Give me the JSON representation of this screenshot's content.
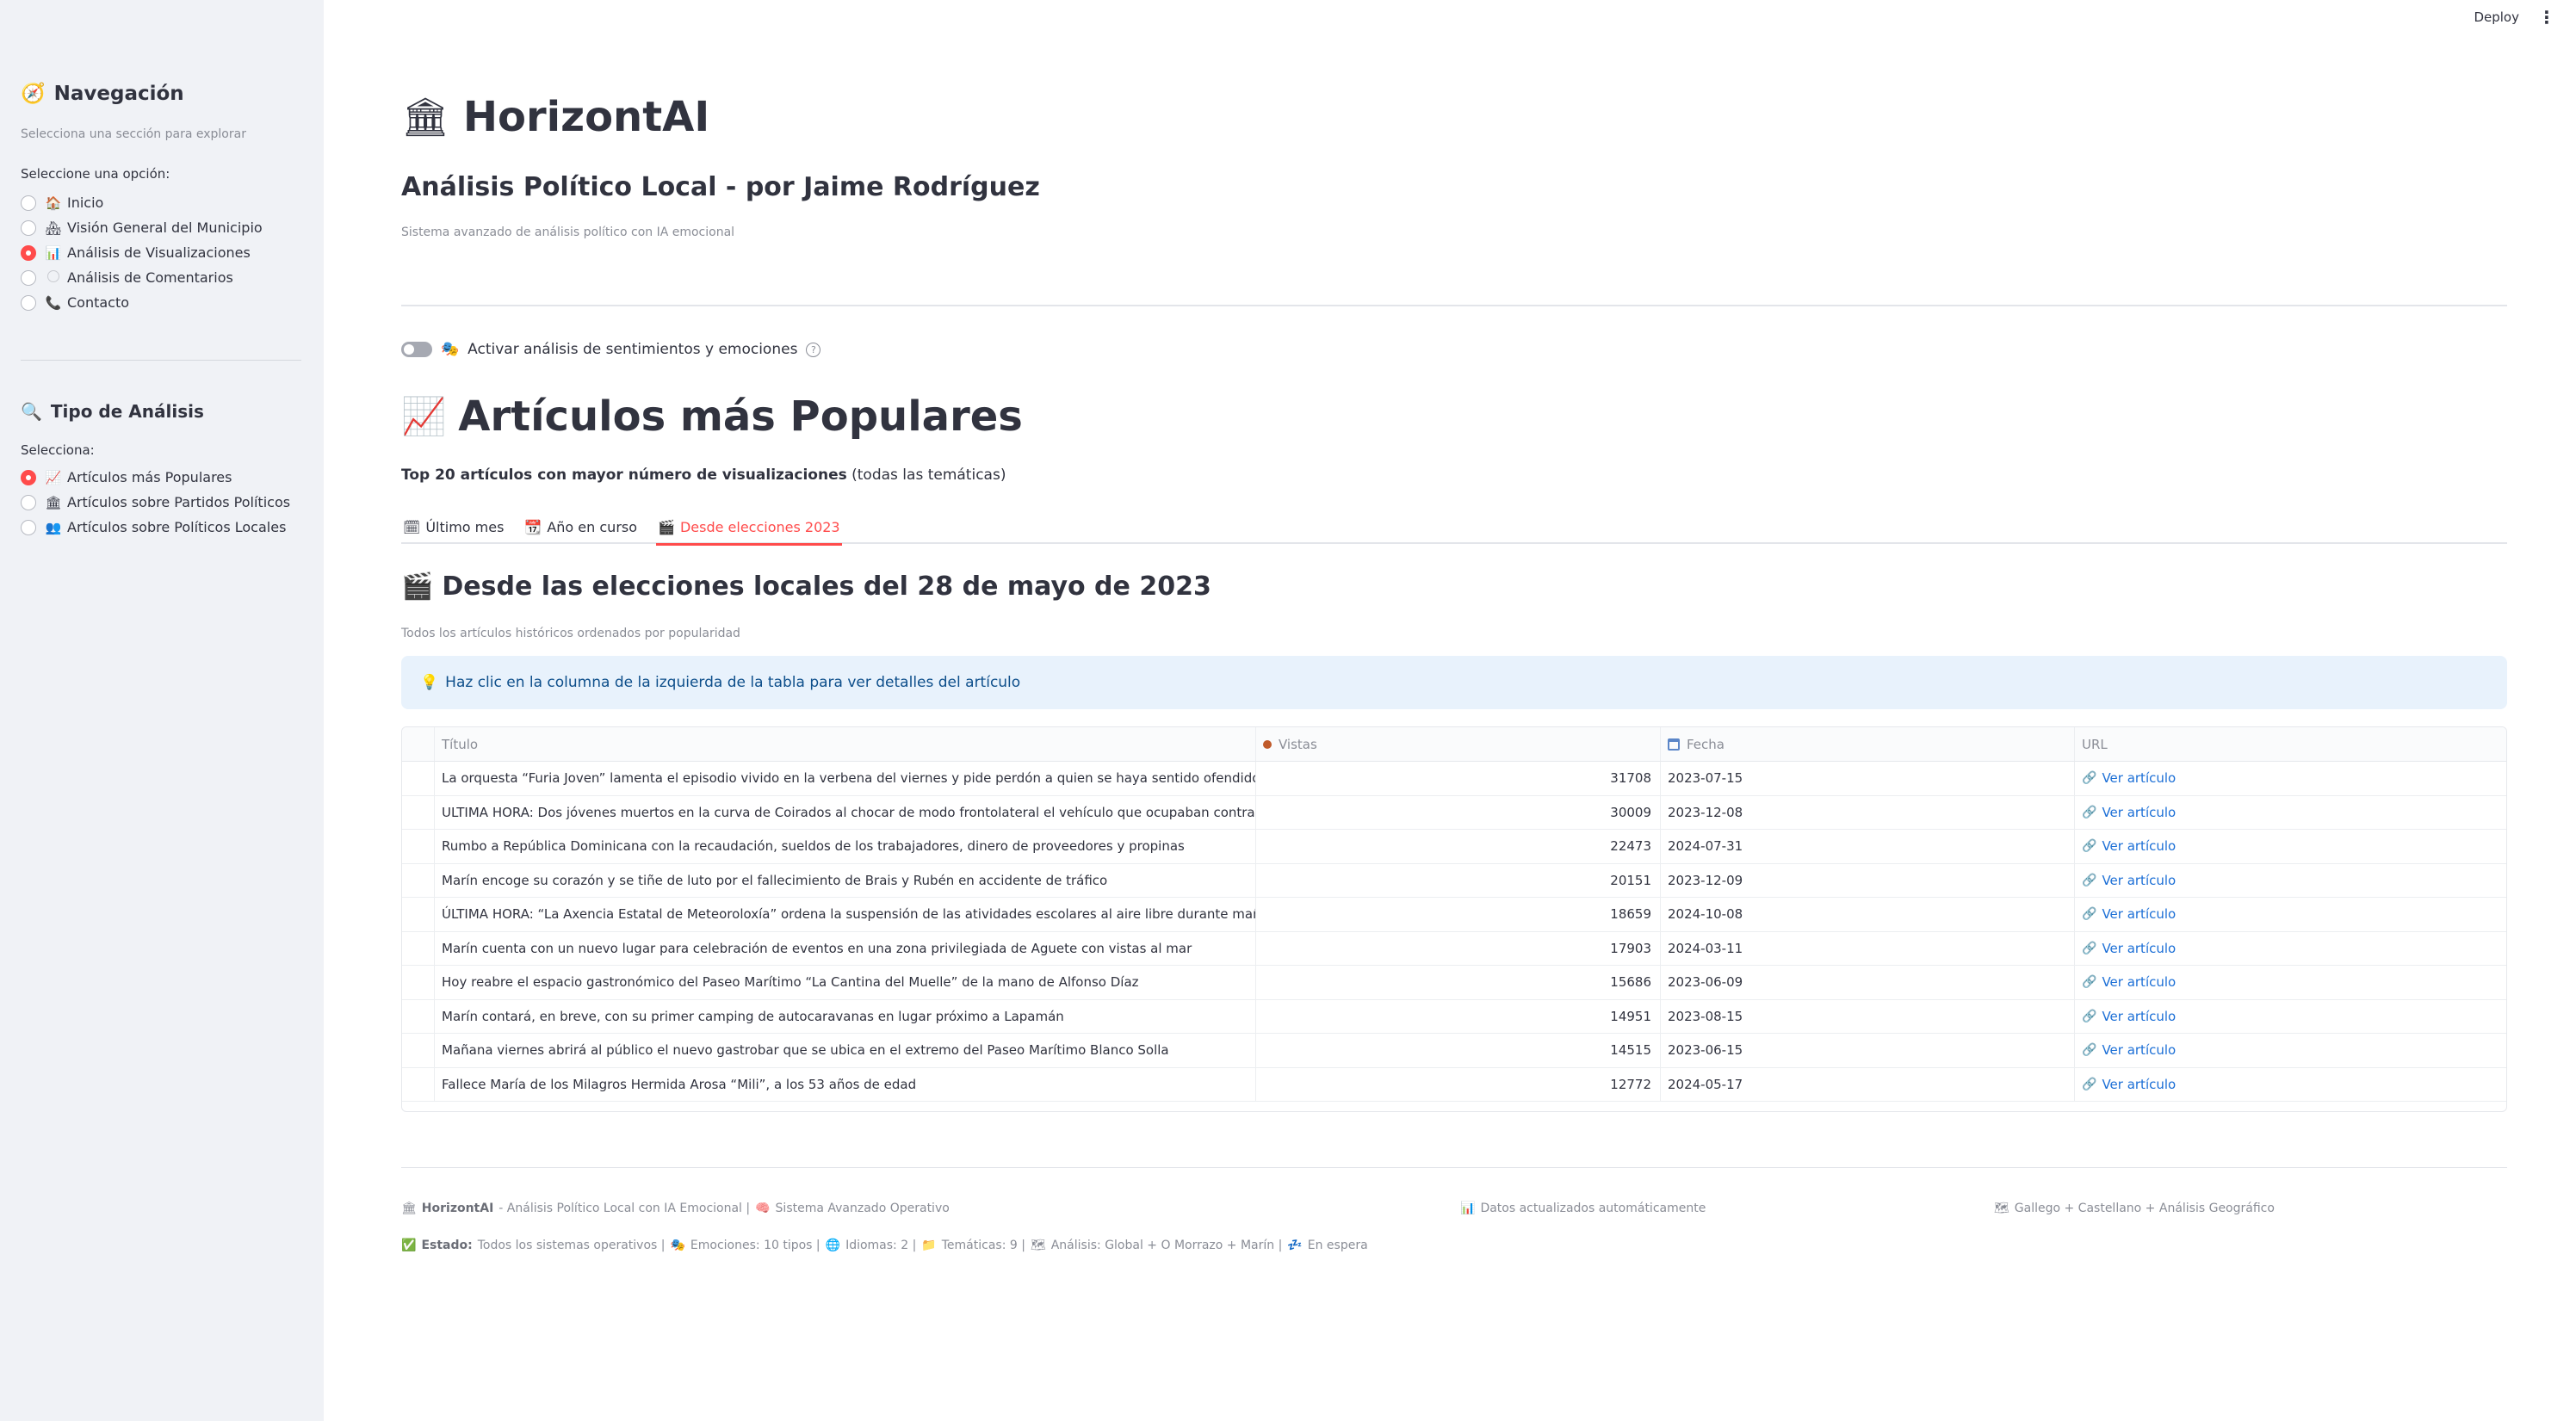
{
  "topbar": {
    "deploy_label": "Deploy"
  },
  "sidebar": {
    "nav_heading": "Navegación",
    "nav_caption": "Selecciona una sección para explorar",
    "nav_label": "Seleccione una opción:",
    "nav_items": [
      {
        "icon": "🏠",
        "label": "Inicio",
        "selected": false
      },
      {
        "icon": "🏘",
        "label": "Visión General del Municipio",
        "selected": false
      },
      {
        "icon": "📊",
        "label": "Análisis de Visualizaciones",
        "selected": true
      },
      {
        "icon": "",
        "label": "Análisis de Comentarios",
        "selected": false
      },
      {
        "icon": "📞",
        "label": "Contacto",
        "selected": false
      }
    ],
    "analysis_heading": "Tipo de Análisis",
    "analysis_label": "Selecciona:",
    "analysis_items": [
      {
        "icon": "📈",
        "label": "Artículos más Populares",
        "selected": true
      },
      {
        "icon": "🏛",
        "label": "Artículos sobre Partidos Políticos",
        "selected": false
      },
      {
        "icon": "👥",
        "label": "Artículos sobre Políticos Locales",
        "selected": false
      }
    ]
  },
  "header": {
    "app_title": "HorizontAI",
    "subtitle": "Análisis Político Local - por Jaime Rodríguez",
    "caption": "Sistema avanzado de análisis político con IA emocional"
  },
  "toggle": {
    "label": "Activar análisis de sentimientos y emociones",
    "on": false
  },
  "section": {
    "title": "Artículos más Populares",
    "desc_bold": "Top 20 artículos con mayor número de visualizaciones",
    "desc_rest": " (todas las temáticas)"
  },
  "tabs": [
    {
      "label": "Último mes",
      "active": false
    },
    {
      "label": "Año en curso",
      "active": false
    },
    {
      "label": "Desde elecciones 2023",
      "active": true
    }
  ],
  "subsection": {
    "title": "Desde las elecciones locales del 28 de mayo de 2023",
    "caption": "Todos los artículos históricos ordenados por popularidad"
  },
  "info": {
    "text": "Haz clic en la columna de la izquierda de la tabla para ver detalles del artículo"
  },
  "table": {
    "headers": {
      "title": "Título",
      "views": "Vistas",
      "date": "Fecha",
      "url": "URL"
    },
    "link_text": "Ver artículo",
    "rows": [
      {
        "title": "La orquesta “Furia Joven” lamenta el episodio vivido en la verbena del viernes y pide perdón a quien se haya sentido ofendido",
        "views": "31708",
        "date": "2023-07-15"
      },
      {
        "title": "ULTIMA HORA: Dos jóvenes muertos  en la curva de Coirados al chocar de modo frontolateral el vehículo que ocupaban contra otro",
        "views": "30009",
        "date": "2023-12-08"
      },
      {
        "title": "Rumbo a República Dominicana con la recaudación, sueldos de los trabajadores, dinero de proveedores y propinas",
        "views": "22473",
        "date": "2024-07-31"
      },
      {
        "title": "Marín encoge su corazón y se tiñe de luto por el fallecimiento de Brais y Rubén en accidente de tráfico",
        "views": "20151",
        "date": "2023-12-09"
      },
      {
        "title": "ÚLTIMA HORA: “La Axencia Estatal de Meteoroloxía” ordena la suspensión de las atividades escolares al aire libre durante mañana miércoles",
        "views": "18659",
        "date": "2024-10-08"
      },
      {
        "title": "Marín cuenta con un nuevo lugar para celebración de eventos en una zona privilegiada de Aguete con vistas al mar",
        "views": "17903",
        "date": "2024-03-11"
      },
      {
        "title": "Hoy reabre el espacio gastronómico del Paseo Marítimo “La Cantina del Muelle” de la mano de Alfonso Díaz",
        "views": "15686",
        "date": "2023-06-09"
      },
      {
        "title": "Marín contará, en breve, con su primer camping de autocaravanas en lugar próximo a Lapamán",
        "views": "14951",
        "date": "2023-08-15"
      },
      {
        "title": "Mañana viernes abrirá al público el nuevo gastrobar que se ubica en el extremo del Paseo Marítimo Blanco Solla",
        "views": "14515",
        "date": "2023-06-15"
      },
      {
        "title": "Fallece María de los Milagros Hermida Arosa “Mili”, a los 53 años de edad",
        "views": "12772",
        "date": "2024-05-17"
      }
    ]
  },
  "footer": {
    "brand": "HorizontAI",
    "brand_rest": " - Análisis Político Local con IA Emocional | ",
    "system": "Sistema Avanzado Operativo",
    "updated": "Datos actualizados automáticamente",
    "langs": "Gallego + Castellano + Análisis Geográfico",
    "status_label": "Estado:",
    "status_rest": " Todos los sistemas operativos | ",
    "emotions": "Emociones: 10 tipos | ",
    "languages": "Idiomas: 2 | ",
    "topics": "Temáticas: 9 | ",
    "analysis": "Análisis: Global + O Morrazo + Marín | ",
    "waiting": "En espera"
  },
  "colors": {
    "accent": "#ff4b4b",
    "link": "#1c6fd6",
    "info_bg": "#e8f2fc",
    "sidebar_bg": "#f0f2f6"
  }
}
